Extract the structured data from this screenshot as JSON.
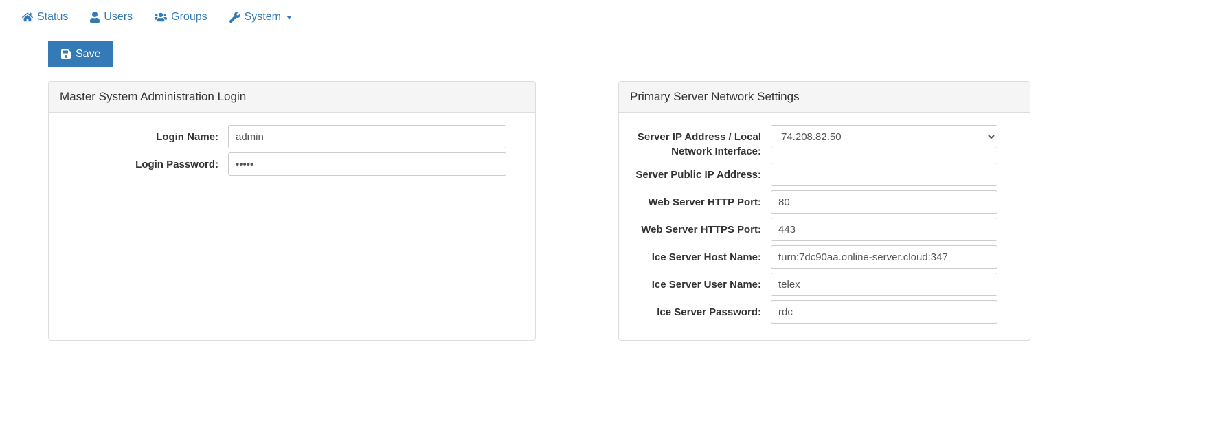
{
  "nav": {
    "status": "Status",
    "users": "Users",
    "groups": "Groups",
    "system": "System"
  },
  "toolbar": {
    "save_label": "Save"
  },
  "panel1": {
    "title": "Master System Administration Login",
    "login_name_label": "Login Name:",
    "login_name_value": "admin",
    "login_password_label": "Login Password:",
    "login_password_value": "•••••"
  },
  "panel2": {
    "title": "Primary Server Network Settings",
    "server_ip_label": "Server IP Address / Local Network Interface:",
    "server_ip_value": "74.208.82.50",
    "public_ip_label": "Server Public IP Address:",
    "public_ip_value": "",
    "http_port_label": "Web Server HTTP Port:",
    "http_port_value": "80",
    "https_port_label": "Web Server HTTPS Port:",
    "https_port_value": "443",
    "ice_host_label": "Ice Server Host Name:",
    "ice_host_value": "turn:7dc90aa.online-server.cloud:347",
    "ice_user_label": "Ice Server User Name:",
    "ice_user_value": "telex",
    "ice_pass_label": "Ice Server Password:",
    "ice_pass_value": "rdc"
  }
}
